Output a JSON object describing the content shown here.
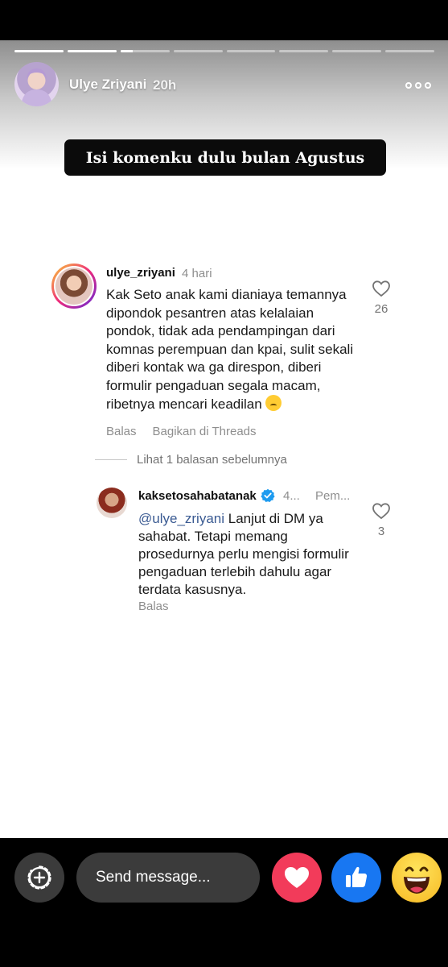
{
  "story": {
    "progress_segments": [
      {
        "fill": 1
      },
      {
        "fill": 1
      },
      {
        "fill": 0.25
      },
      {
        "fill": 0
      },
      {
        "fill": 0
      },
      {
        "fill": 0
      },
      {
        "fill": 0
      },
      {
        "fill": 0
      }
    ],
    "username": "Ulye Zriyani",
    "time": "20h",
    "more_icon": "more-horizontal-icon",
    "caption": "Isi komenku dulu bulan Agustus"
  },
  "comment": {
    "username": "ulye_zriyani",
    "time": "4 hari",
    "text": "Kak Seto anak kami dianiaya temannya dipondok pesantren atas kelalaian pondok, tidak ada pendampingan dari komnas perempuan dan kpai, sulit sekali diberi kontak wa ga direspon, diberi formulir pengaduan segala macam, ribetnya mencari keadilan",
    "emoji": "sad-face-emoji",
    "likes": "26",
    "reply_label": "Balas",
    "share_label": "Bagikan di Threads"
  },
  "view_replies": "Lihat 1 balasan sebelumnya",
  "reply": {
    "username": "kaksetosahabatanak",
    "verified": true,
    "time": "4...",
    "author_label": "Pem...",
    "mention": "@ulye_zriyani",
    "text": " Lanjut di DM ya sahabat. Tetapi memang prosedurnya perlu mengisi formulir pengaduan terlebih dahulu agar terdata kasusnya.",
    "likes": "3",
    "reply_label": "Balas"
  },
  "bottom_bar": {
    "placeholder": "Send message...",
    "reactions": [
      "heart-icon",
      "thumbs-up-icon",
      "laughing-face-icon"
    ],
    "colors": {
      "love": "#f23b5a",
      "like": "#1877f2",
      "haha": "#f7b924"
    }
  }
}
